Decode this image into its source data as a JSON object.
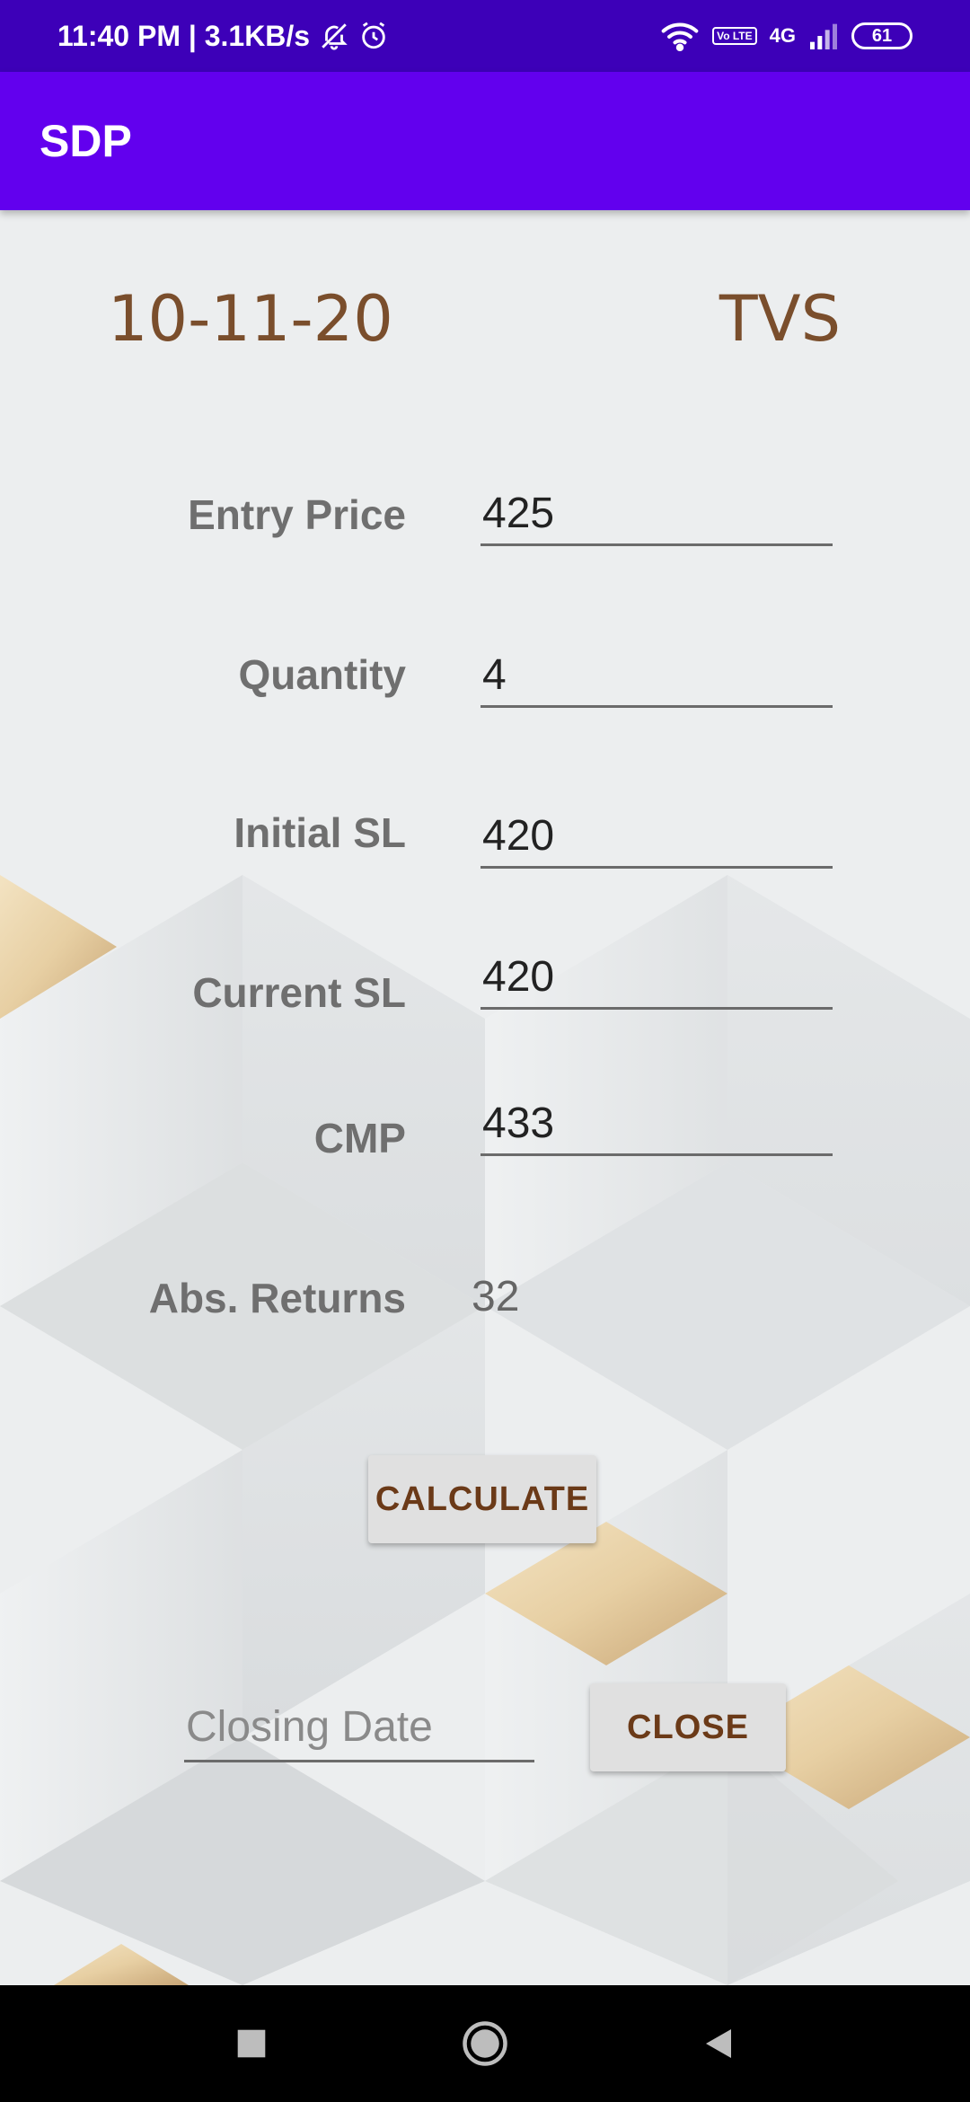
{
  "status_bar": {
    "time_speed": "11:40 PM | 3.1KB/s",
    "network": "4G",
    "volte": "Vo LTE",
    "battery": "61"
  },
  "app_bar": {
    "title": "SDP"
  },
  "trade": {
    "date": "10-11-20",
    "symbol": "TVS"
  },
  "fields": {
    "entry_price": {
      "label": "Entry Price",
      "value": "425"
    },
    "quantity": {
      "label": "Quantity",
      "value": "4"
    },
    "initial_sl": {
      "label": "Initial SL",
      "value": "420"
    },
    "current_sl": {
      "label": "Current SL",
      "value": "420"
    },
    "cmp": {
      "label": "CMP",
      "value": "433"
    },
    "abs_returns": {
      "label": "Abs. Returns",
      "value": "32"
    }
  },
  "buttons": {
    "calculate": "CALCULATE",
    "close": "CLOSE"
  },
  "closing": {
    "placeholder": "Closing Date"
  },
  "colors": {
    "status_bar": "#3d00b8",
    "app_bar": "#6200ee",
    "header_text": "#7a4e2c",
    "button_text": "#6b3a18"
  }
}
